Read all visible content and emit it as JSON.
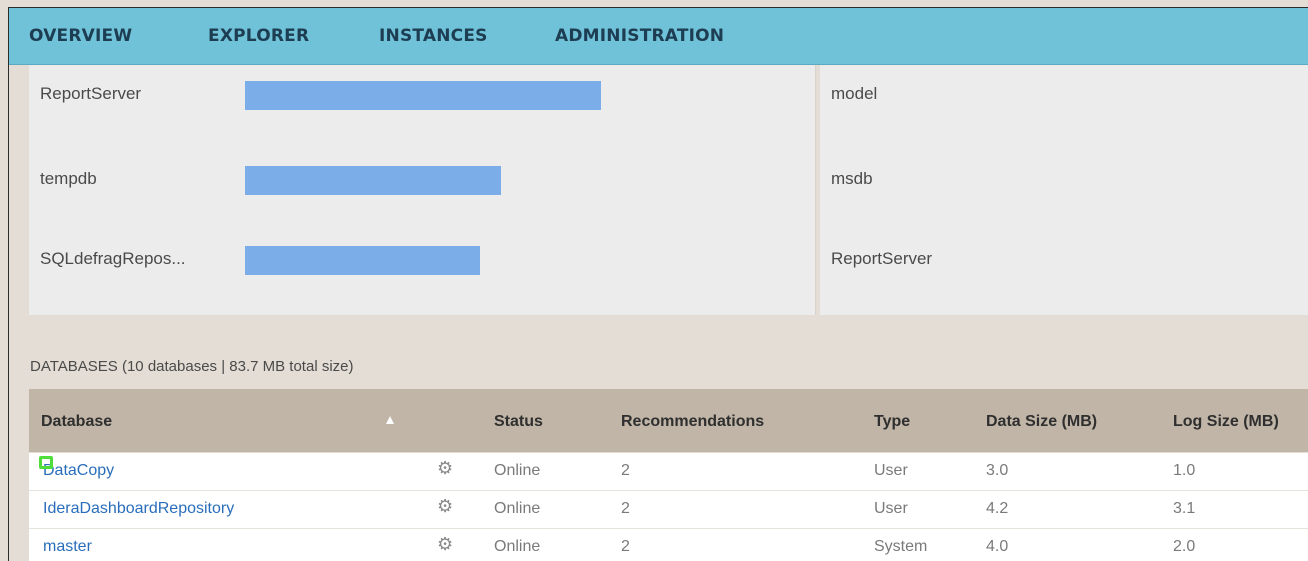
{
  "nav": {
    "items": [
      "OVERVIEW",
      "EXPLORER",
      "INSTANCES",
      "ADMINISTRATION"
    ]
  },
  "left_panel": {
    "rows": [
      {
        "label": "ReportServer",
        "bar_fraction": 1.0
      },
      {
        "label": "tempdb",
        "bar_fraction": 0.72
      },
      {
        "label": "SQLdefragRepos...",
        "bar_fraction": 0.66
      }
    ]
  },
  "right_panel": {
    "rows": [
      "model",
      "msdb",
      "ReportServer"
    ]
  },
  "databases": {
    "summary": "DATABASES (10 databases | 83.7 MB total size)",
    "columns": [
      "Database",
      "Status",
      "Recommendations",
      "Type",
      "Data Size (MB)",
      "Log Size (MB)"
    ],
    "rows": [
      {
        "name": "DataCopy",
        "status": "Online",
        "recommendations": "2",
        "type": "User",
        "data_size": "3.0",
        "log_size": "1.0"
      },
      {
        "name": "IderaDashboardRepository",
        "status": "Online",
        "recommendations": "2",
        "type": "User",
        "data_size": "4.2",
        "log_size": "3.1"
      },
      {
        "name": "master",
        "status": "Online",
        "recommendations": "2",
        "type": "System",
        "data_size": "4.0",
        "log_size": "2.0"
      }
    ]
  },
  "icons": {
    "sort": "sort-ascending-icon",
    "settings": "gear-icon"
  },
  "colors": {
    "nav": "#70c2d9",
    "bar": "#7baee8",
    "link": "#2a6ebb",
    "highlight": "#4fdd3a",
    "table_header": "#c0b5a7"
  }
}
